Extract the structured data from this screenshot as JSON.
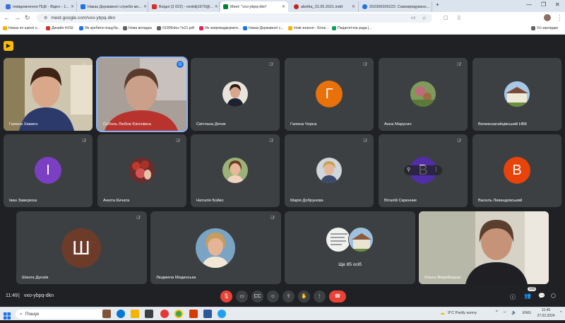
{
  "browser": {
    "tabs": [
      {
        "title": "повідомлення ПЦК - Відео - 1...",
        "color": "#3f6fd8"
      },
      {
        "title": "Наказ Державної служби мо...",
        "color": "#1a73e8"
      },
      {
        "title": "Вхідні (3 022) - vedolij1979@...",
        "color": "#d93025"
      },
      {
        "title": "Meet: \"vxo-ybpq-dkn\"",
        "color": "#00832d"
      },
      {
        "title": "abetka_31.05.2021.indd",
        "color": "#c5221f"
      },
      {
        "title": "202300026222: Самоврядуванн...",
        "color": "#1a73e8"
      }
    ],
    "url": "meet.google.com/vxo-ybpq-dkn",
    "bookmarks": [
      "Наказ по школі о...",
      "Дизайн НУШ",
      "Як зробити пощуба...",
      "Нова вкладка",
      "01006nbu-7e21.pdf",
      "Як запроваджувати...",
      "Наказ Державної с...",
      "Нові знання - Блок...",
      "Педагогічна рада |..."
    ],
    "all_bookmarks": "Усі закладки"
  },
  "meet": {
    "participants": [
      {
        "name": "Галина Хамига",
        "type": "video"
      },
      {
        "name": "Соболь Любов Євгенівна",
        "type": "video"
      },
      {
        "name": "Світлана Дячок",
        "type": "photo"
      },
      {
        "name": "Галина Чорна",
        "type": "letter",
        "letter": "Г",
        "color": "#e8710a"
      },
      {
        "name": "Анна Марусин",
        "type": "photo"
      },
      {
        "name": "Великозагайцівський НВК",
        "type": "photo"
      },
      {
        "name": "Іван Заверюха",
        "type": "letter",
        "letter": "І",
        "color": "#7b3fc4"
      },
      {
        "name": "Анюта Кичата",
        "type": "photo"
      },
      {
        "name": "Наталія Бойко",
        "type": "photo"
      },
      {
        "name": "Марія Добрунова",
        "type": "photo"
      },
      {
        "name": "Віталій Скринник",
        "type": "letter",
        "letter": "В",
        "color": "#512da8"
      },
      {
        "name": "Василь Левандовський",
        "type": "letter",
        "letter": "В",
        "color": "#e8430a"
      },
      {
        "name": "Школа Дунаїв",
        "type": "letter",
        "letter": "Ш",
        "color": "#6d3b2a"
      },
      {
        "name": "Людмила Мединська",
        "type": "photo"
      },
      {
        "name": "Ще 85 осіб",
        "type": "more"
      },
      {
        "name": "Ольга Жеребецька",
        "type": "video"
      }
    ],
    "time": "11:49",
    "meeting_code": "vxo-ybpq-dkn",
    "participant_count": "100"
  },
  "taskbar": {
    "search": "Пошук",
    "weather": "9°C  Partly sunny",
    "lang": "ENG",
    "clock_time": "11:49",
    "clock_date": "27.02.2024"
  }
}
